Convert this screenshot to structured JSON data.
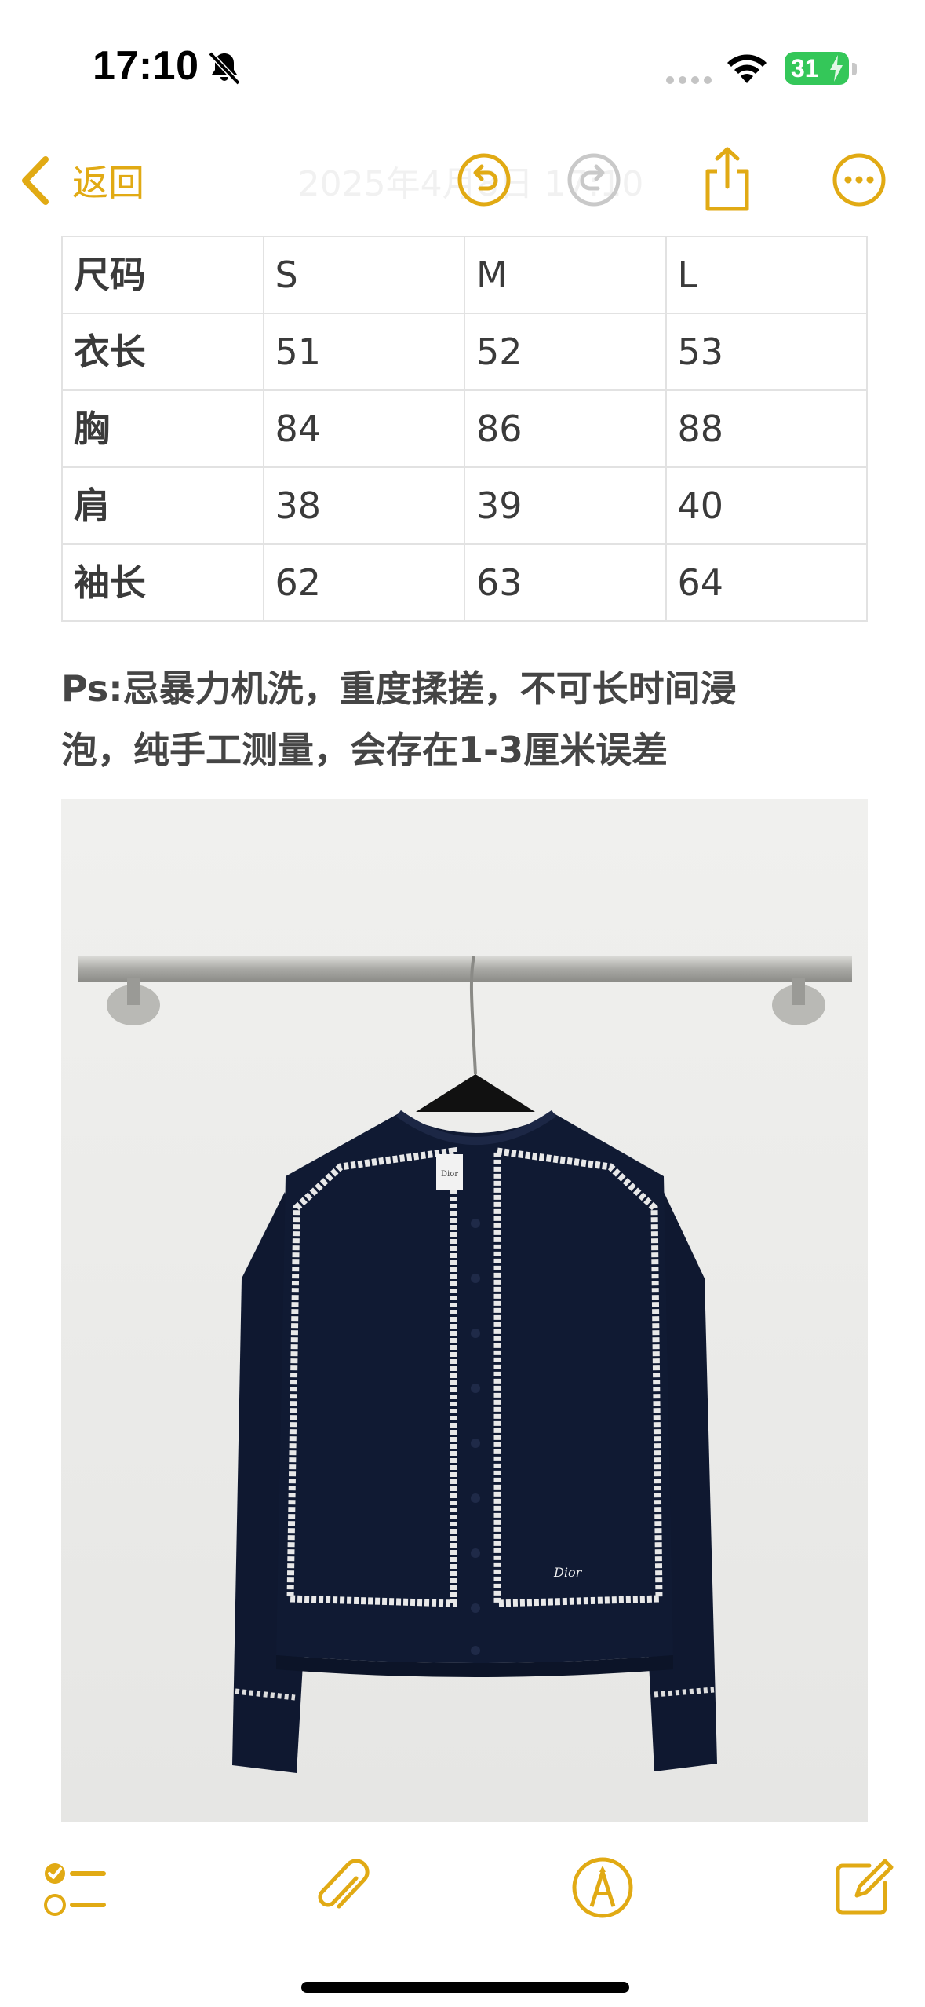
{
  "status_bar": {
    "time": "17:10",
    "battery_level": "31"
  },
  "nav": {
    "back_label": "返回",
    "title": "2025年4月8日 17:10"
  },
  "size_table": {
    "header": [
      "尺码",
      "S",
      "M",
      "L"
    ],
    "rows": [
      [
        "衣长",
        "51",
        "52",
        "53"
      ],
      [
        "胸",
        "84",
        "86",
        "88"
      ],
      [
        "肩",
        "38",
        "39",
        "40"
      ],
      [
        "袖长",
        "62",
        "63",
        "64"
      ]
    ]
  },
  "note": {
    "line1": "Ps:忌暴力机洗，重度揉搓，不可长时间浸",
    "line2": "泡，纯手工测量，会存在1-3厘米误差"
  },
  "photo": {
    "garment_label_text": "Dior",
    "garment_embroidery_text": "Dior"
  },
  "colors": {
    "accent": "#e1aa14",
    "battery_green": "#34c759",
    "table_border": "#e2e2e2",
    "garment_navy": "#0f1830"
  },
  "icons": {
    "back": "chevron-left-icon",
    "undo": "undo-icon",
    "redo": "redo-icon",
    "share": "share-icon",
    "more": "ellipsis-circle-icon",
    "checklist": "checklist-icon",
    "attach": "paperclip-icon",
    "markup": "markup-pen-icon",
    "compose": "compose-icon"
  }
}
